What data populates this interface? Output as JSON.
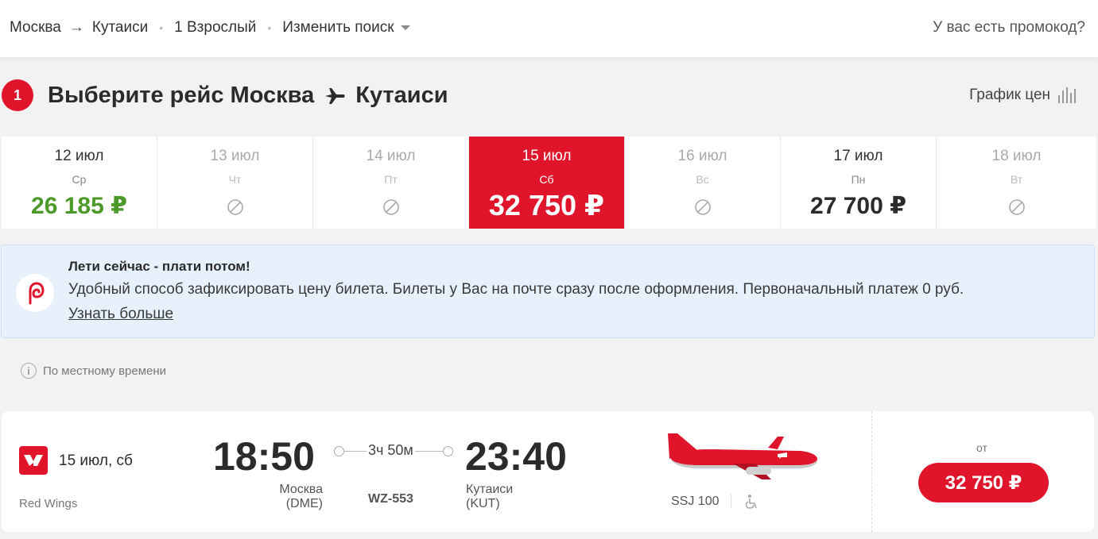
{
  "header": {
    "origin": "Москва",
    "destination": "Кутаиси",
    "passengers": "1 Взрослый",
    "change_search": "Изменить поиск",
    "promo": "У вас есть промокод?"
  },
  "section": {
    "step": "1",
    "title_prefix": "Выберите рейс Москва",
    "title_dest": "Кутаиси",
    "price_graph": "График цен"
  },
  "dates": [
    {
      "date": "12 июл",
      "weekday": "Ср",
      "price": "26 185 ₽",
      "state": "available-cheapest"
    },
    {
      "date": "13 июл",
      "weekday": "Чт",
      "price": "",
      "state": "unavailable"
    },
    {
      "date": "14 июл",
      "weekday": "Пт",
      "price": "",
      "state": "unavailable"
    },
    {
      "date": "15 июл",
      "weekday": "Сб",
      "price": "32 750 ₽",
      "state": "selected"
    },
    {
      "date": "16 июл",
      "weekday": "Вс",
      "price": "",
      "state": "unavailable"
    },
    {
      "date": "17 июл",
      "weekday": "Пн",
      "price": "27 700 ₽",
      "state": "available"
    },
    {
      "date": "18 июл",
      "weekday": "Вт",
      "price": "",
      "state": "unavailable"
    }
  ],
  "banner": {
    "title": "Лети сейчас - плати потом!",
    "text": "Удобный способ зафиксировать цену билета. Билеты у Вас на почте сразу после оформления. Первоначальный платеж 0 руб.",
    "link": "Узнать больше"
  },
  "note": "По местному времени",
  "flight": {
    "date": "15 июл, сб",
    "airline": "Red Wings",
    "dep_time": "18:50",
    "dep_city": "Москва",
    "dep_code": "(DME)",
    "duration": "3ч 50м",
    "flight_no": "WZ-553",
    "arr_time": "23:40",
    "arr_city": "Кутаиси",
    "arr_code": "(KUT)",
    "aircraft": "SSJ 100",
    "from_label": "от",
    "price": "32 750 ₽"
  },
  "colors": {
    "brand_red": "#e0152b",
    "cheap_green": "#4c9a2a",
    "banner_bg": "#e7f1fb"
  }
}
